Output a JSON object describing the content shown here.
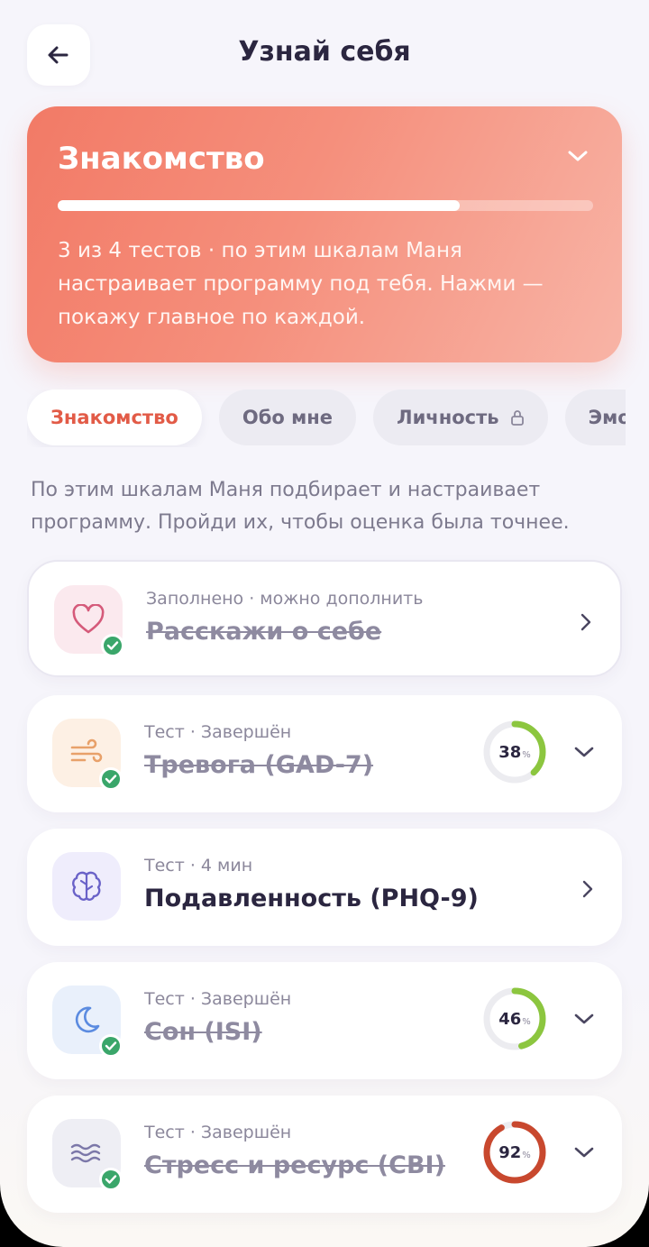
{
  "header": {
    "title": "Узнай себя"
  },
  "hero": {
    "title": "Знакомство",
    "progress": 0.75,
    "description": "3 из 4 тестов · по этим шкалам Маня настраивает программу под тебя. Нажми — покажу главное по каждой."
  },
  "tabs": [
    {
      "label": "Знакомство",
      "active": true,
      "locked": false
    },
    {
      "label": "Обо мне",
      "active": false,
      "locked": false
    },
    {
      "label": "Личность",
      "active": false,
      "locked": true
    },
    {
      "label": "Эмоции",
      "active": false,
      "locked": false
    }
  ],
  "intro": "По этим шкалам Маня подбирает и настраивает программу. Пройди их, чтобы оценка была точнее.",
  "cards": [
    {
      "meta": "Заполнено · можно дополнить",
      "title": "Расскажи о себе",
      "done": true,
      "icon": "heart-icon",
      "action": "chevron-right"
    },
    {
      "meta": "Тест · Завершён",
      "title": "Тревога (GAD-7)",
      "done": true,
      "icon": "wind-icon",
      "score": 38,
      "score_unit": "%",
      "ring_color": "#8cc63f",
      "action": "chevron-down"
    },
    {
      "meta": "Тест · 4 мин",
      "title": "Подавленность (PHQ-9)",
      "done": false,
      "icon": "brain-icon",
      "action": "chevron-right"
    },
    {
      "meta": "Тест · Завершён",
      "title": "Сон (ISI)",
      "done": true,
      "icon": "moon-icon",
      "score": 46,
      "score_unit": "%",
      "ring_color": "#8cc63f",
      "action": "chevron-down"
    },
    {
      "meta": "Тест · Завершён",
      "title": "Стресс и ресурс (CBI)",
      "done": true,
      "icon": "waves-icon",
      "score": 92,
      "score_unit": "%",
      "ring_color": "#c8482e",
      "action": "chevron-down"
    }
  ],
  "colors": {
    "accent": "#e25b47",
    "success": "#3aa66a",
    "hero_start": "#f27a66",
    "hero_end": "#f8b4a6"
  }
}
